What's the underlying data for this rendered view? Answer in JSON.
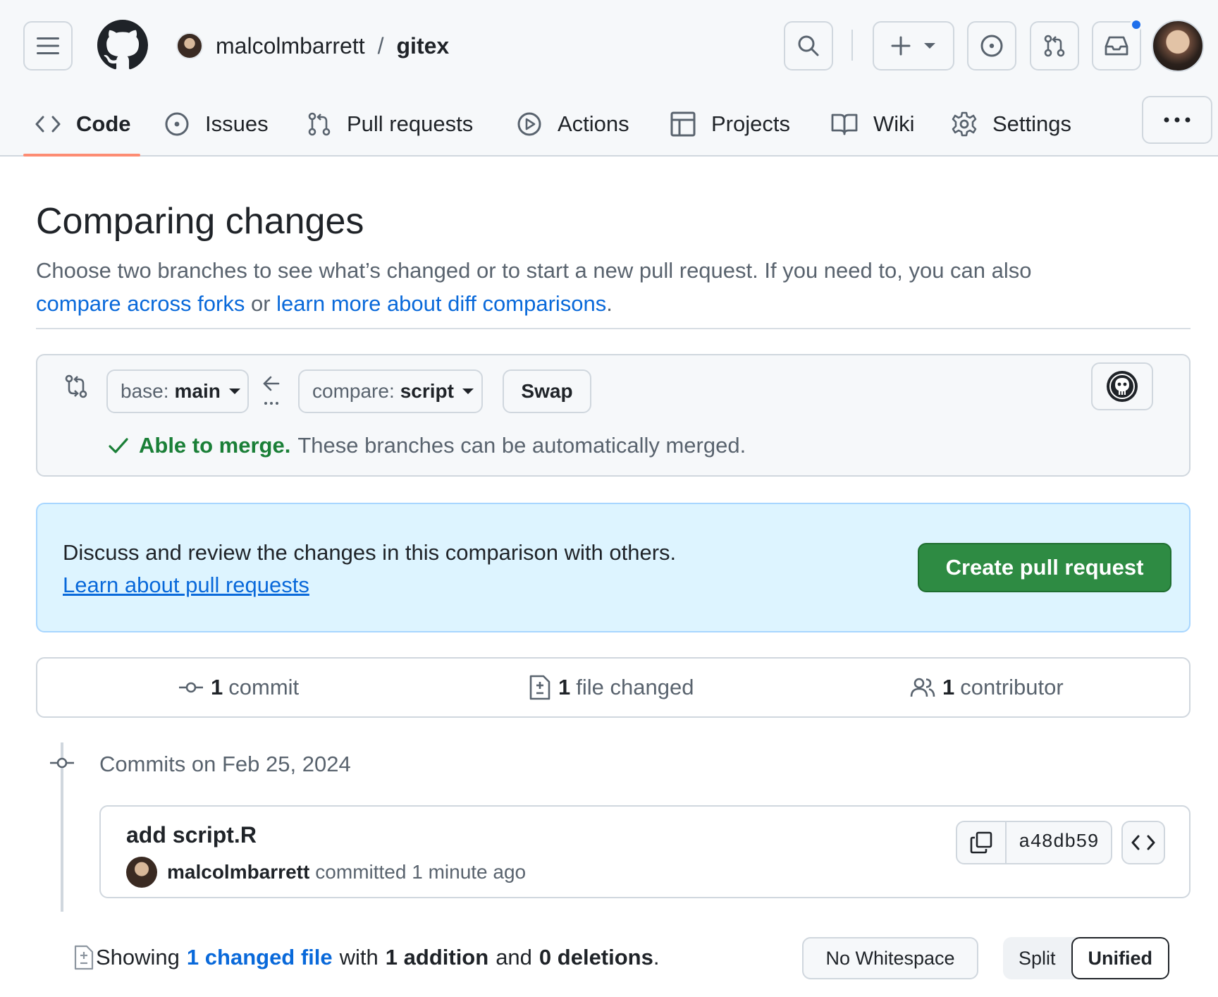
{
  "repo": {
    "owner": "malcolmbarrett",
    "separator": "/",
    "name": "gitex"
  },
  "nav": {
    "tabs": [
      {
        "label": "Code",
        "icon": "code-icon",
        "active": true
      },
      {
        "label": "Issues",
        "icon": "issue-icon"
      },
      {
        "label": "Pull requests",
        "icon": "pull-request-icon"
      },
      {
        "label": "Actions",
        "icon": "play-icon"
      },
      {
        "label": "Projects",
        "icon": "table-icon"
      },
      {
        "label": "Wiki",
        "icon": "book-icon"
      },
      {
        "label": "Settings",
        "icon": "gear-icon"
      }
    ]
  },
  "page": {
    "title": "Comparing changes",
    "desc_text": "Choose two branches to see what’s changed or to start a new pull request. If you need to, you can also",
    "link_forks": "compare across forks",
    "desc_or": "or",
    "link_learn": "learn more about diff comparisons",
    "desc_end": "."
  },
  "range": {
    "base_label": "base:",
    "base_value": "main",
    "compare_label": "compare:",
    "compare_value": "script",
    "swap_label": "Swap",
    "merge_ok": "Able to merge.",
    "merge_text": "These branches can be automatically merged."
  },
  "info": {
    "text": "Discuss and review the changes in this comparison with others.",
    "link": "Learn about pull requests",
    "create_button": "Create pull request"
  },
  "summary": {
    "commits_num": "1",
    "commits_label": "commit",
    "files_num": "1",
    "files_label": "file changed",
    "contributors_num": "1",
    "contributors_label": "contributor"
  },
  "commits": {
    "date_label": "Commits on Feb 25, 2024",
    "items": [
      {
        "message": "add script.R",
        "author": "malcolmbarrett",
        "action": "committed 1 minute ago",
        "sha": "a48db59"
      }
    ]
  },
  "files": {
    "showing": "Showing",
    "changed_link": "1 changed file",
    "with": "with",
    "additions": "1 addition",
    "and": "and",
    "deletions": "0 deletions",
    "end": ".",
    "no_whitespace": "No Whitespace",
    "split": "Split",
    "unified": "Unified"
  },
  "colors": {
    "accent_blue": "#0969da",
    "success_green": "#1a7f37",
    "button_green": "#2e8b43",
    "tab_underline": "#fd8c73",
    "notification_dot": "#1f6feb"
  }
}
